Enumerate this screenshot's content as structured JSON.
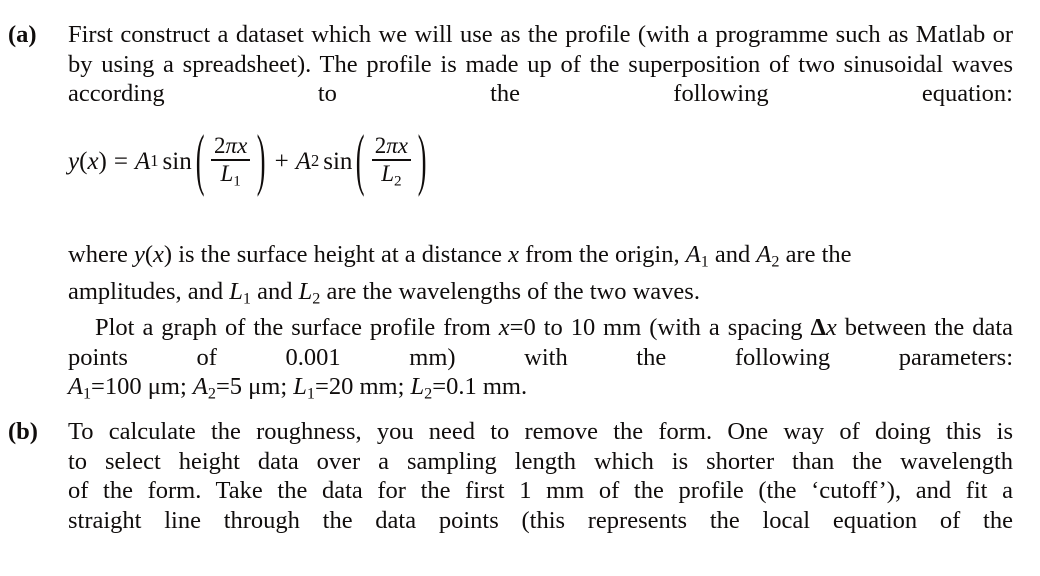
{
  "document": {
    "type": "textbook-exercise",
    "background_color": "#ffffff",
    "text_color": "#100d0c"
  },
  "items": [
    {
      "label": "(a)",
      "lines": [
        "First construct a dataset which we will use as the profile (with a programme such",
        "as Matlab or by using a spreadsheet). The profile is made up of the superposition",
        "of two sinusoidal waves according to the following equation:"
      ],
      "text": "First construct a dataset which we will use as the profile (with a programme such as Matlab or by using a spreadsheet). The profile is made up of the superposition of two sinusoidal waves according to the following equation:"
    },
    {
      "label": "(b)",
      "lines": [
        "To calculate the roughness, you need to remove the form. One way of doing this is",
        "to select height data over a sampling length which is shorter than the wavelength",
        "of the form. Take the data for the first 1 mm of the profile (the ‘cutoff’), and fit a",
        "straight line through the data points (this represents the local equation of the"
      ],
      "text": "To calculate the roughness, you need to remove the form. One way of doing this is to select height data over a sampling length which is shorter than the wavelength of the form. Take the data for the first 1 mm of the profile (the ‘cutoff’), and fit a straight line through the data points (this represents the local equation of the"
    }
  ],
  "equation": {
    "lhs_function": "y",
    "lhs_variable": "x",
    "equals": "=",
    "plus": "+",
    "sin_label": "sin",
    "term1": {
      "amplitude": "A",
      "amplitude_subscript": "1",
      "numerator_coefficient": "2",
      "numerator_pi": "π",
      "numerator_variable": "x",
      "denominator": "L",
      "denominator_subscript": "1"
    },
    "term2": {
      "amplitude": "A",
      "amplitude_subscript": "2",
      "numerator_coefficient": "2",
      "numerator_pi": "π",
      "numerator_variable": "x",
      "denominator": "L",
      "denominator_subscript": "2"
    },
    "paren_left": "(",
    "paren_right": ")",
    "plain_text": "y(x) = A₁ sin(2πx/L₁) + A₂ sin(2πx/L₂)"
  },
  "where_paragraph": {
    "seg1": "where ",
    "var_y": "y",
    "paren_open": "(",
    "var_x": "x",
    "paren_close": ")",
    "seg2": " is the surface height at a distance ",
    "var_x2": "x",
    "seg3": " from the origin, ",
    "var_A": "A",
    "sub_1": "1",
    "seg4": " and ",
    "var_A2": "A",
    "sub_2": "2",
    "seg5": " are the",
    "line2_seg1": "amplitudes, and ",
    "line2_var_L": "L",
    "line2_sub_1": "1",
    "line2_seg2": " and ",
    "line2_var_L2": "L",
    "line2_sub_2": "2",
    "line2_seg3": " are the wavelengths of the two waves.",
    "plain_text": "where y(x) is the surface height at a distance x from the origin, A1 and A2 are the amplitudes, and L1 and L2 are the wavelengths of the two waves."
  },
  "plot_paragraph": {
    "seg1": "Plot a graph of the surface profile from ",
    "var_x": "x",
    "equals": "=",
    "val_0": "0",
    "seg2": " to 10 mm (with a spacing ",
    "delta": "Δ",
    "var_x2": "x",
    "seg3": "between the data points of 0.001 mm) with the following parameters:",
    "plain_text": "Plot a graph of the surface profile from x=0 to 10 mm (with a spacing Δx between the data points of 0.001 mm) with the following parameters:"
  },
  "parameters": {
    "A1": {
      "symbol": "A",
      "subscript": "1",
      "equals": "=",
      "value": "100",
      "unit": "μm",
      "separator": ";"
    },
    "A2": {
      "symbol": "A",
      "subscript": "2",
      "equals": "=",
      "value": "5",
      "unit": "μm",
      "separator": ";"
    },
    "L1": {
      "symbol": "L",
      "subscript": "1",
      "equals": "=",
      "value": "20",
      "unit": "mm",
      "separator": ";"
    },
    "L2": {
      "symbol": "L",
      "subscript": "2",
      "equals": "=",
      "value": "0.1",
      "unit": "mm",
      "separator": "."
    },
    "plain_text": "A1 = 100 μm; A2 = 5 μm; L1 = 20 mm; L2 = 0.1 mm."
  },
  "item_b_text": {
    "line1": "To calculate the roughness, you need to remove the form. One way of doing this is",
    "line2": "to select height data over a sampling length which is shorter than the wavelength",
    "line3_seg1": "of the form. Take the data for the first ",
    "line3_num": "1",
    "line3_seg2": " mm of the profile (the ‘cutoff’), and fit a",
    "line4": "straight line through the data points (this represents the local equation of the"
  }
}
